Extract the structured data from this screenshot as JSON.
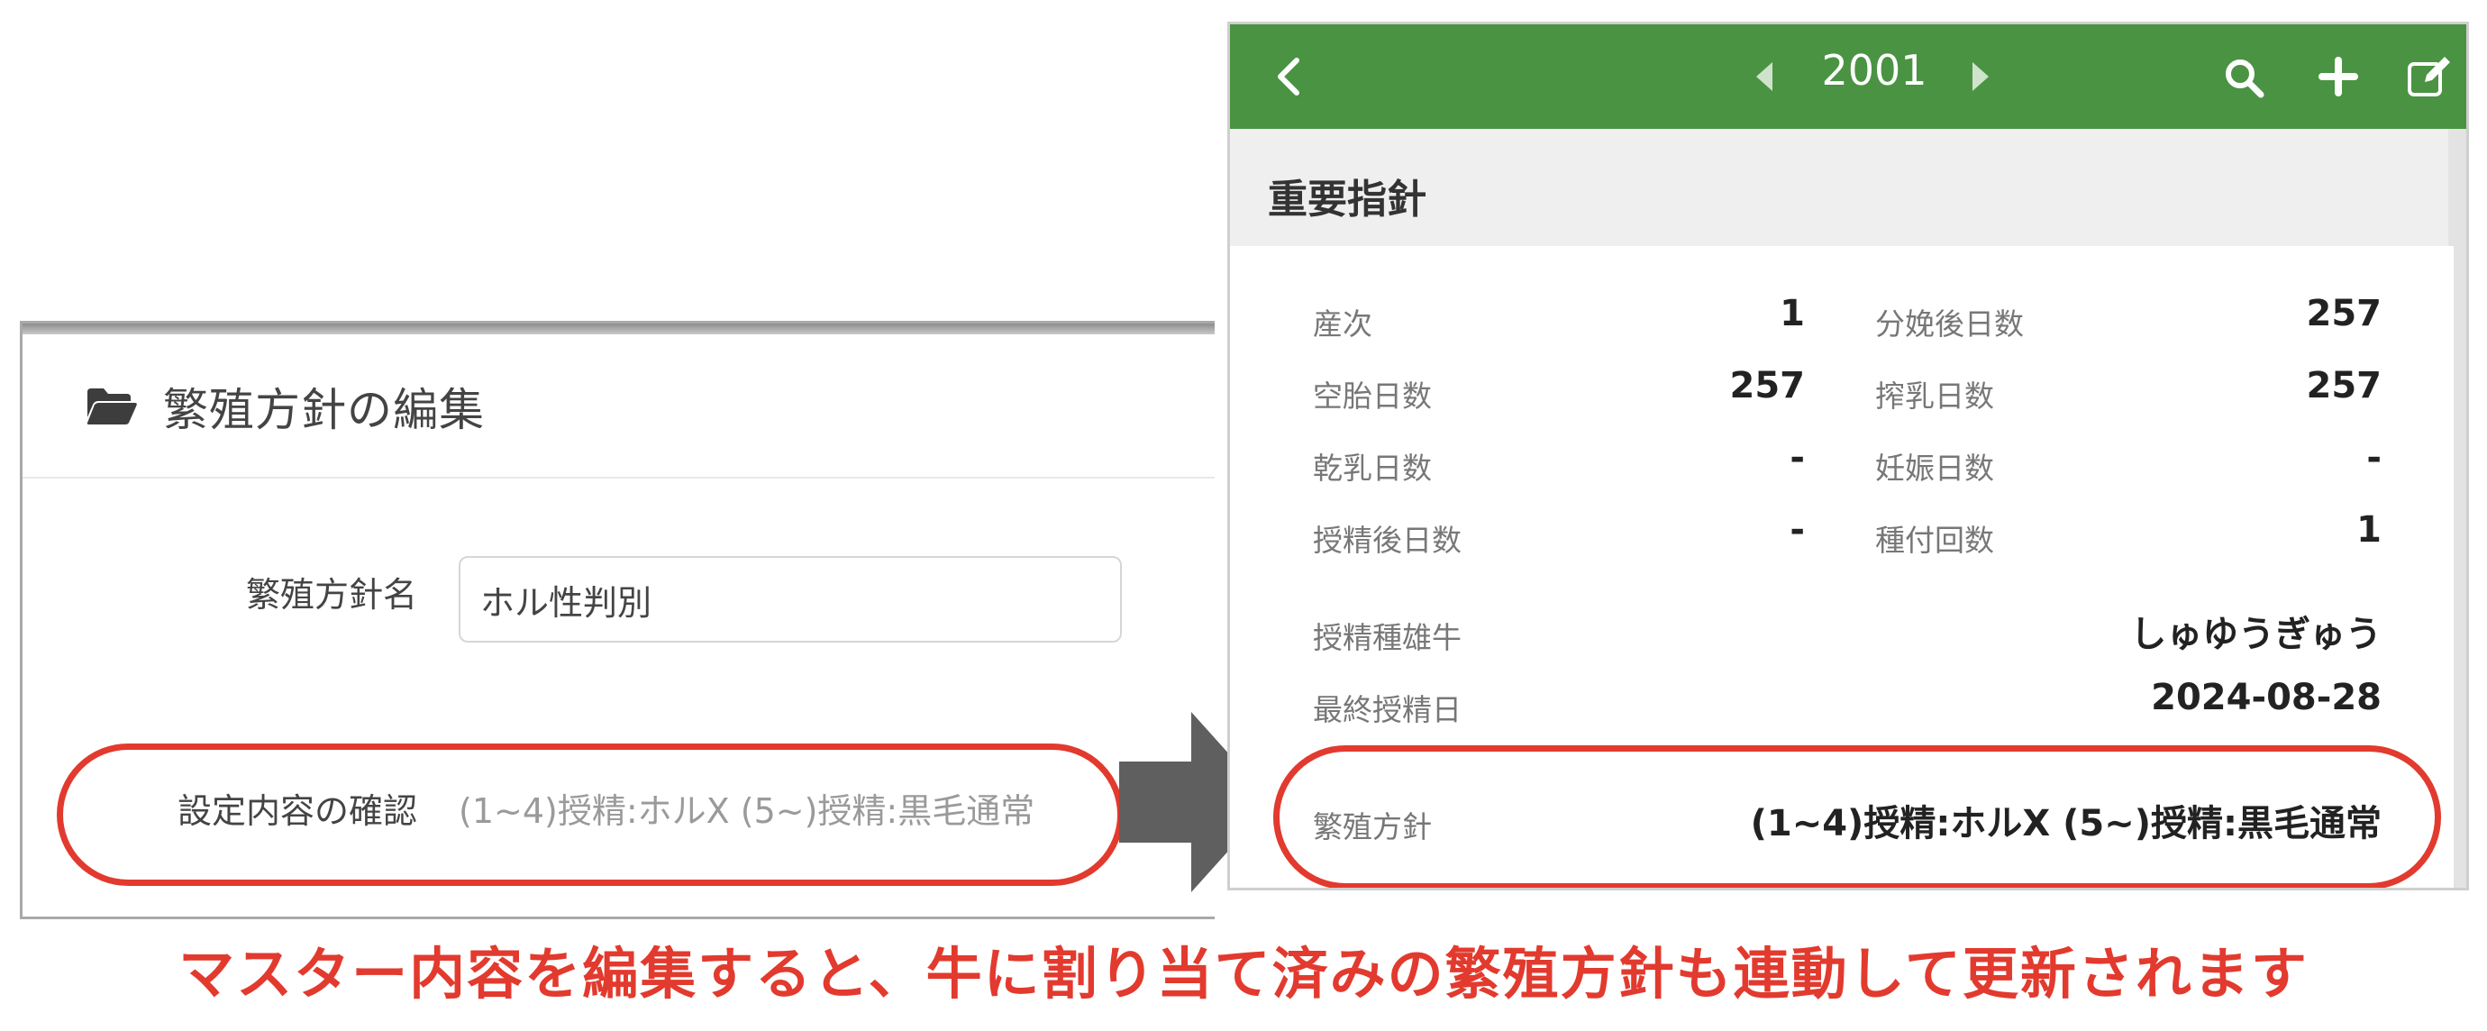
{
  "edit_modal": {
    "title": "繁殖方針の編集",
    "name_label": "繁殖方針名",
    "name_value": "ホル性判別",
    "confirm_label": "設定内容の確認",
    "confirm_value": "(1~4)授精:ホルX (5~)授精:黒毛通常",
    "icon": "folder-open-icon"
  },
  "phone": {
    "nav": {
      "title": "2001",
      "icons": [
        "back-icon",
        "prev-icon",
        "next-icon",
        "search-icon",
        "plus-icon",
        "edit-icon"
      ]
    },
    "section_title": "重要指針",
    "stats": [
      {
        "label": "産次",
        "value": "1"
      },
      {
        "label": "分娩後日数",
        "value": "257"
      },
      {
        "label": "空胎日数",
        "value": "257"
      },
      {
        "label": "搾乳日数",
        "value": "257"
      },
      {
        "label": "乾乳日数",
        "value": "-"
      },
      {
        "label": "妊娠日数",
        "value": "-"
      },
      {
        "label": "授精後日数",
        "value": "-"
      },
      {
        "label": "種付回数",
        "value": "1"
      }
    ],
    "bull": {
      "label": "授精種雄牛",
      "value": "しゅゆうぎゅう"
    },
    "last_insem": {
      "label": "最終授精日",
      "value": "2024-08-28"
    },
    "policy": {
      "label": "繁殖方針",
      "value": "(1~4)授精:ホルX (5~)授精:黒毛通常"
    }
  },
  "caption": "マスター内容を編集すると、牛に割り当て済みの繁殖方針も連動して更新されます",
  "colors": {
    "accent_red": "#e23a2e",
    "nav_green": "#4a9342",
    "arrow_gray": "#5f5f5f"
  }
}
